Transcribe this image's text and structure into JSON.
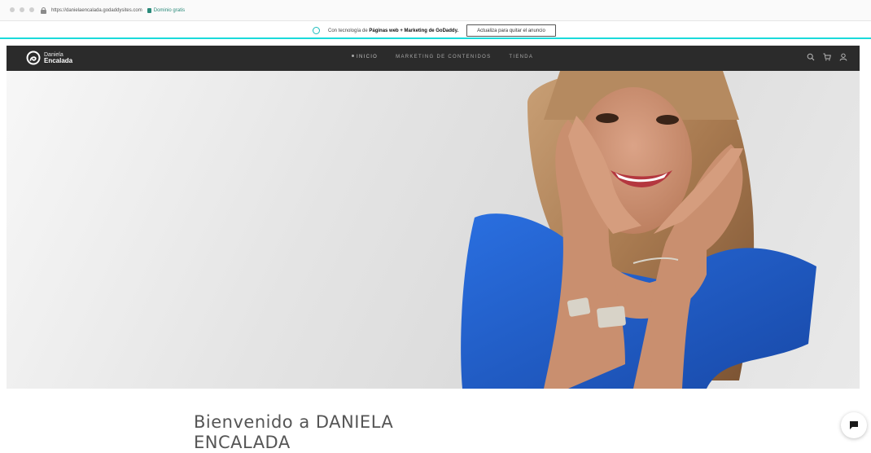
{
  "browser": {
    "url": "https://danielaencalada.godaddysites.com",
    "free_domain_label": "Dominio gratis"
  },
  "ad_bar": {
    "text_prefix": "Con tecnología de ",
    "text_bold": "Páginas web + Marketing de GoDaddy.",
    "button_label": "Actualiza para quitar el anuncio",
    "accent_color": "#1bdbdb"
  },
  "header": {
    "logo_line1": "Daniela",
    "logo_line2": "Encalada",
    "nav": [
      {
        "label": "INICIO",
        "active": true
      },
      {
        "label": "MARKETING DE CONTENIDOS",
        "active": false
      },
      {
        "label": "TIENDA",
        "active": false
      }
    ],
    "icons": [
      "search-icon",
      "cart-icon",
      "account-icon"
    ],
    "background_color": "#2b2b2b"
  },
  "hero": {
    "image": "woman-smiling-blue-dress-photo",
    "dress_color": "#1f5fd0"
  },
  "welcome": {
    "title": "Bienvenido a DANIELA ENCALADA"
  },
  "chat": {
    "icon": "chat-icon"
  }
}
